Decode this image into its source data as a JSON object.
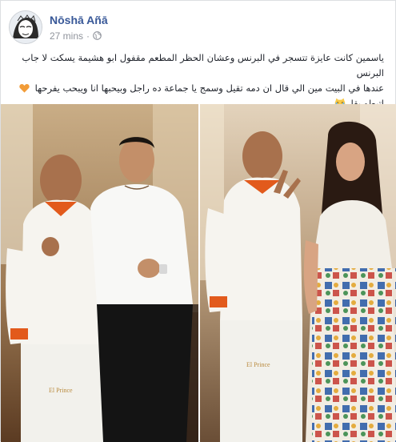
{
  "post": {
    "author": "Nōshā Añā",
    "time": "27 mins",
    "privacy_icon": "globe-icon",
    "text_lines": [
      "ياسمين كانت عايزة تتسجر في البرنس وعشان الحظر المطعم مقفول ابو هشيمة يسكت لا جاب البرنس",
      "عندها في البيت مين الي قال ان دمه تقيل وسمج يا جماعة ده راجل وبيحبها انا ويبحب يفرحها",
      "اتبطو بقا"
    ],
    "heart_emoji": "orange-heart-icon",
    "laugh_emoji": "laughing-crying-cat-icon",
    "chef_badge_left": "El Prince",
    "chef_badge_right": "El Prince"
  },
  "colors": {
    "link": "#385898",
    "meta": "#90949c",
    "heart": "#f29c38",
    "chef_accent": "#e25a1c"
  }
}
